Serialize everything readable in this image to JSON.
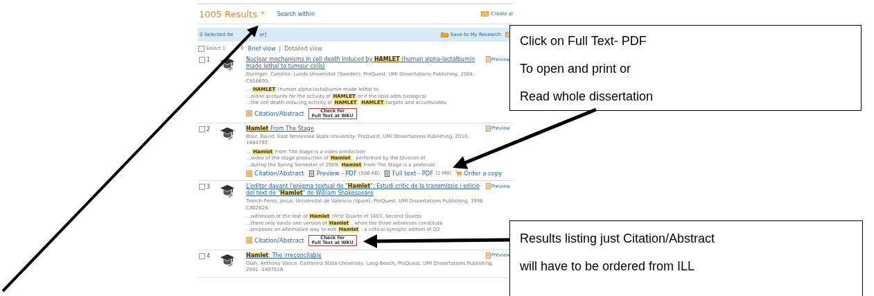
{
  "header": {
    "results_count": "1005 Results",
    "star": "*",
    "search_within": "Search within",
    "create_alert": "Create al"
  },
  "selection_bar": {
    "selected_text": "0 Selected ite",
    "clear_fragment": "ar]",
    "save": "Save to My Research"
  },
  "view_bar": {
    "select_all": {
      "label": "Select 1",
      "label_tail": "0",
      "checked": false
    },
    "views": [
      {
        "label": "Brief view",
        "selected": false
      },
      {
        "label": "Detailed view",
        "selected": true
      }
    ],
    "separator": "|"
  },
  "results": [
    {
      "number": "1",
      "checked": false,
      "title": "Nuclear mechanisms in cell death induced by **HAMLET** (human alpha-lactalbumin made lethal to tumour cells)",
      "preview": "Preview",
      "citation": "Duringer, Caroline. Lunds Universitet (Sweden), ProQuest, UMI Dissertations Publishing, 2004. C816695.",
      "snippets": [
        "... **HAMLET** (human alpha-lactalbumin made lethal to",
        "...alone accounts for the activity of **HAMLET** or if the lipid adds biological",
        "...the cell death-inducing activity of **HAMLET**. **HAMLET** targets and accumulates"
      ],
      "links": [
        {
          "kind": "citation",
          "label": "Citation/Abstract"
        },
        {
          "kind": "check",
          "label": "Check for",
          "label2": "Full Text at WKU"
        }
      ]
    },
    {
      "number": "2",
      "checked": false,
      "title": "**Hamlet** From The Stage",
      "preview": "Preview",
      "citation": "Blair, David. East Tennessee State University, ProQuest, UMI Dissertations Publishing, 2010. 1484792.",
      "snippets": [
        "... **Hamlet** From The Stage is a video production",
        "...video of the stage production of **Hamlet** , performed by the Division of",
        "...during the Spring Semester of 2009. **Hamlet** From The Stage is a professio"
      ],
      "links": [
        {
          "kind": "citation",
          "label": "Citation/Abstract"
        },
        {
          "kind": "pdf",
          "label": "Preview - PDF",
          "size": "(506 KB)"
        },
        {
          "kind": "pdf",
          "label": "Full text - PDF",
          "size": "(2 MB)"
        },
        {
          "kind": "order",
          "label": "Order a copy"
        }
      ]
    },
    {
      "number": "3",
      "checked": false,
      "title": "L'editor davant l'enigma textual de \"**Hamlet**\": Estudi critic de la transmissio i edicio del text de \"**Hamlet**\" de William Shakespeare",
      "preview": "Preview",
      "citation": "Tronch-Perez, Jesus. Universitat de Valencia (Spain), ProQuest, UMI Dissertations Publishing, 1996. C802626.",
      "snippets": [
        "...witnesses of the text of **Hamlet** (First Quarto of 1603, Second Quarto",
        "...there only exists one version of **Hamlet** , when the three witnesses constitute",
        "...proposes an alternative way to edit **Hamlet** : a critical-synoptic edition of Q2"
      ],
      "links": [
        {
          "kind": "citation",
          "label": "Citation/Abstract"
        },
        {
          "kind": "check",
          "label": "Check for",
          "label2": "Full Text at WKU"
        }
      ]
    },
    {
      "number": "4",
      "checked": false,
      "title": "**Hamlet**: The irreconcilable",
      "preview": "Preview",
      "citation": "Olah, Anthony Vance. California State University, Long Beach, ProQuest, UMI Dissertations Publishing, 2001. 1407518."
    }
  ],
  "callouts": [
    {
      "lines": [
        "Click on Full Text- PDF",
        "To open and print or",
        "Read whole dissertation"
      ]
    },
    {
      "lines": [
        "Results listing just Citation/Abstract",
        "will have to be ordered from ILL"
      ]
    }
  ]
}
